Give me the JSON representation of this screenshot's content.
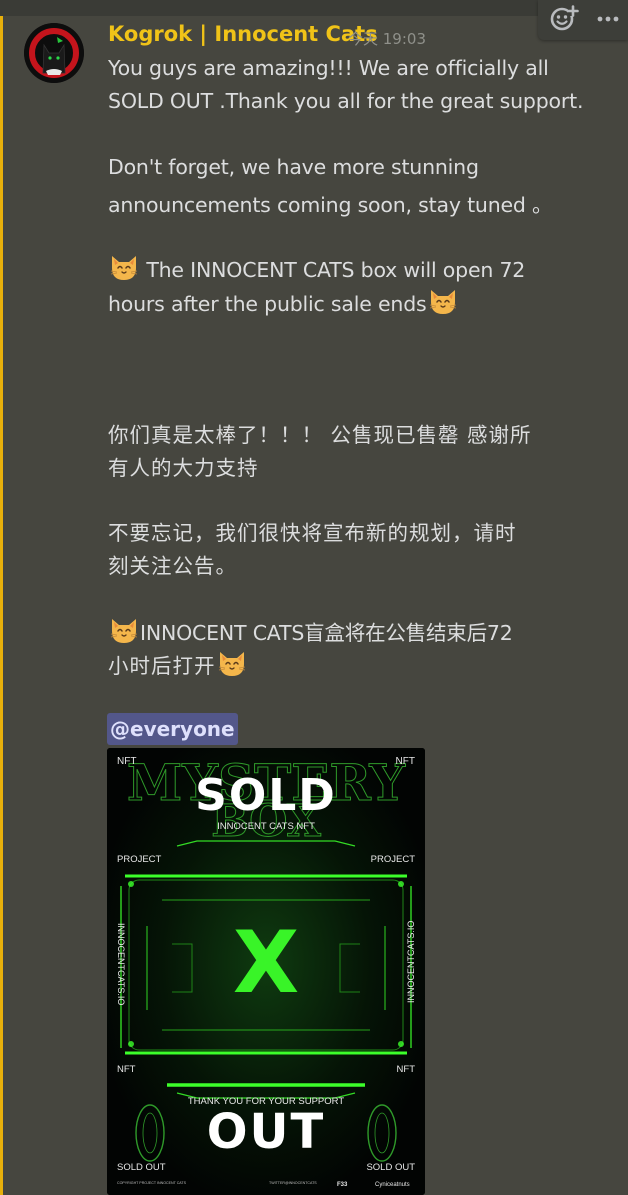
{
  "message": {
    "author": "Kogrok | Innocent Cats",
    "timestamp": "今天 19:03",
    "lines": [
      "You guys are amazing!!! We are officially all",
      "SOLD OUT .Thank you all for the great support.",
      "Don't forget, we have more stunning",
      "announcements coming soon, stay tuned 。",
      " The INNOCENT CATS  box will open 72",
      "hours after the public sale ends",
      "你们真是太棒了！！！ 公售现已售罄  感谢所",
      "有人的大力支持",
      "不要忘记，我们很快将宣布新的规划，请时",
      "刻关注公告。",
      "INNOCENT CATS盲盒将在公售结束后72",
      "小时后打开"
    ],
    "mention": "@everyone",
    "emoji_icon": "cat-face-emoji"
  },
  "poster": {
    "corner_top_left": "NFT",
    "corner_top_right": "NFT",
    "title_top": "SOLD",
    "background_words_1": "MYSTERY",
    "background_words_2": "BOX",
    "subtitle": "INNOCENT CATS NFT",
    "project_left": "PROJECT",
    "project_right": "PROJECT",
    "side_left": "INNOCENTCATS.IO",
    "side_right": "INNOCENTCATS.IO",
    "center_mark": "X",
    "nft_left": "NFT",
    "nft_right": "NFT",
    "thanks": "THANK YOU FOR YOUR SUPPORT",
    "title_bottom": "OUT",
    "sold_left": "SOLD OUT",
    "sold_right": "SOLD OUT",
    "footer_left": "COPYRIGHT PROJECT INNOCENT CATS",
    "footer_mid": "TWITTER@INNOCENTCATS",
    "footer_f": "F33",
    "footer_brand": "Cyniceatnuts",
    "accent_color": "#3cff2a"
  },
  "toolbar": {
    "react_icon": "add-reaction-icon",
    "more_icon": "more-options-icon"
  },
  "colors": {
    "username": "#f0c318",
    "mention_bg": "#53578a",
    "background": "#46463f"
  }
}
